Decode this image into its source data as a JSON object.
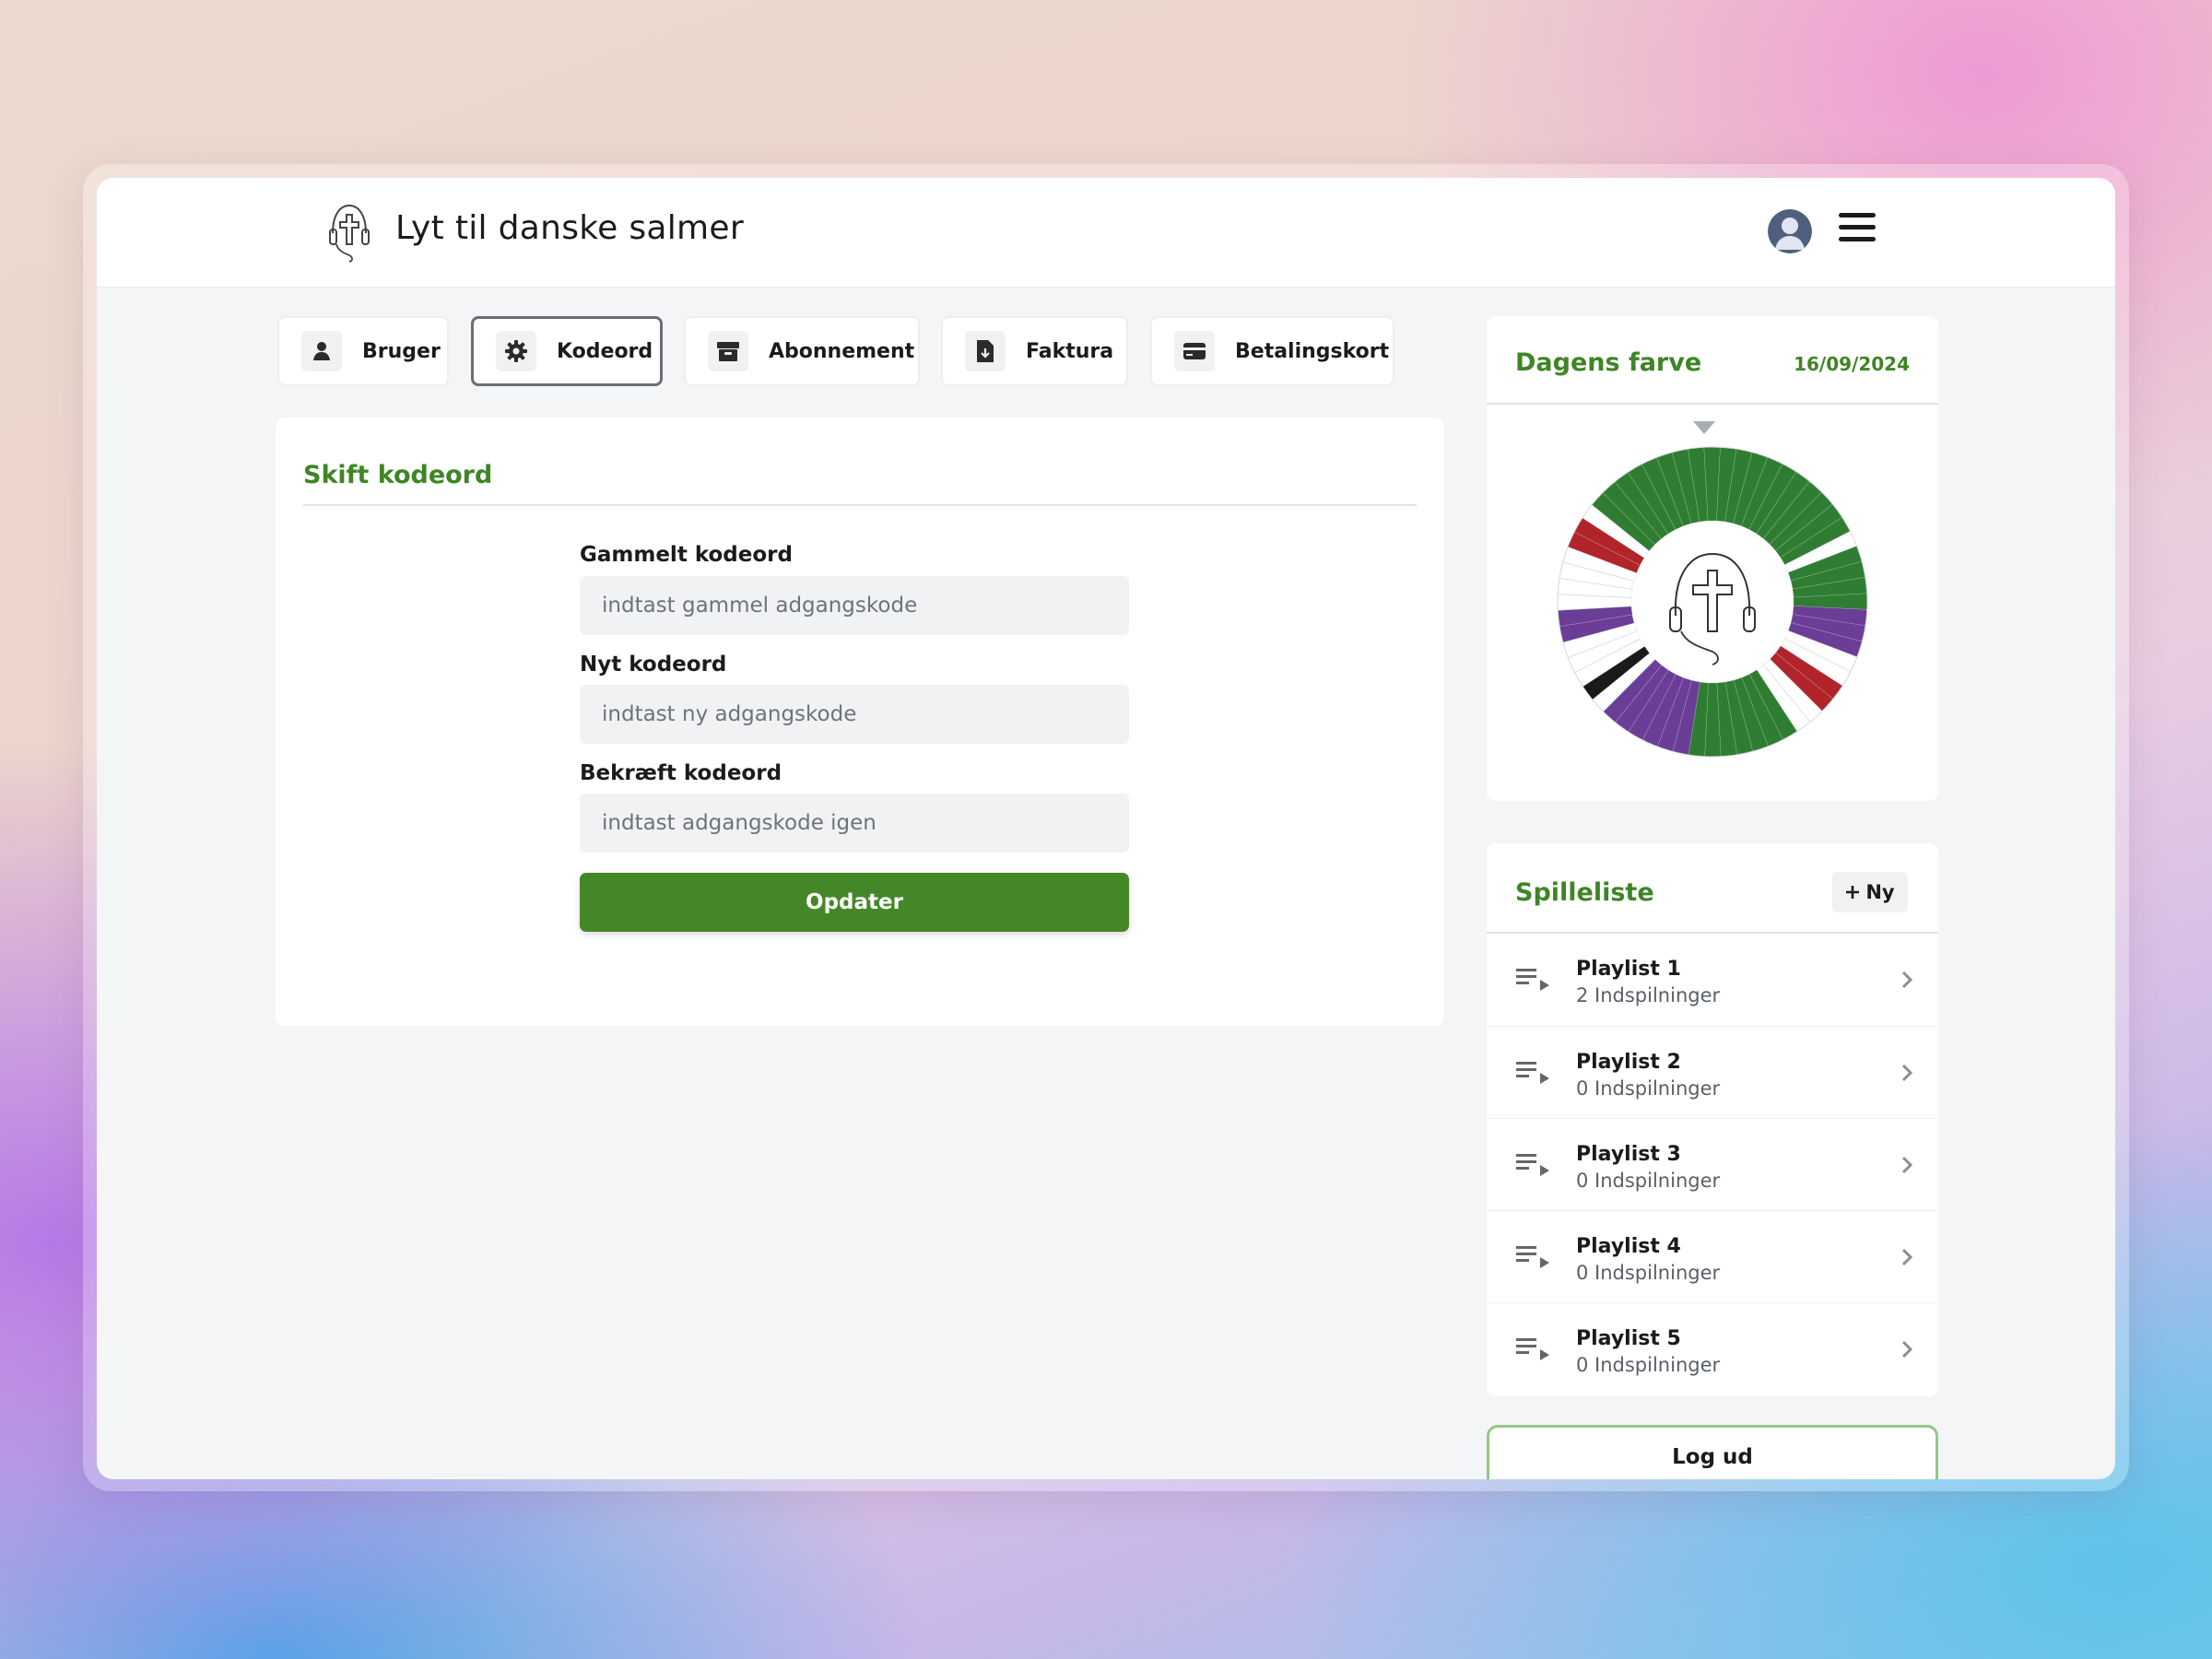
{
  "app": {
    "title": "Lyt til danske salmer"
  },
  "tabs": [
    {
      "label": "Bruger",
      "icon": "user-icon",
      "active": false
    },
    {
      "label": "Kodeord",
      "icon": "gear-icon",
      "active": true
    },
    {
      "label": "Abonnement",
      "icon": "box-icon",
      "active": false
    },
    {
      "label": "Faktura",
      "icon": "file-download-icon",
      "active": false
    },
    {
      "label": "Betalingskort",
      "icon": "credit-card-icon",
      "active": false
    }
  ],
  "password_form": {
    "title": "Skift kodeord",
    "old_label": "Gammelt kodeord",
    "old_placeholder": "indtast gammel adgangskode",
    "new_label": "Nyt kodeord",
    "new_placeholder": "indtast ny adgangskode",
    "confirm_label": "Bekræft kodeord",
    "confirm_placeholder": "indtast adgangskode igen",
    "submit_label": "Opdater"
  },
  "color_of_day": {
    "title": "Dagens farve",
    "date": "16/09/2024",
    "wheel_colors": {
      "green": "#2f7d32",
      "purple": "#6a3d96",
      "red": "#b1242a",
      "white": "#ffffff",
      "black": "#1a1a1a"
    },
    "wheel_segments": [
      "green",
      "green",
      "green",
      "green",
      "green",
      "green",
      "green",
      "green",
      "green",
      "green",
      "white",
      "green",
      "green",
      "green",
      "green",
      "purple",
      "purple",
      "purple",
      "white",
      "white",
      "red",
      "red",
      "white",
      "white",
      "green",
      "green",
      "green",
      "green",
      "green",
      "green",
      "green",
      "purple",
      "purple",
      "purple",
      "purple",
      "purple",
      "purple",
      "white",
      "black",
      "white",
      "white",
      "white",
      "purple",
      "purple",
      "white",
      "white",
      "white",
      "white",
      "red",
      "red",
      "white",
      "green",
      "green",
      "green",
      "green",
      "green",
      "green",
      "green",
      "green",
      "green"
    ]
  },
  "playlists": {
    "title": "Spilleliste",
    "new_label": "Ny",
    "items": [
      {
        "name": "Playlist 1",
        "count": "2 Indspilninger"
      },
      {
        "name": "Playlist 2",
        "count": "0 Indspilninger"
      },
      {
        "name": "Playlist 3",
        "count": "0 Indspilninger"
      },
      {
        "name": "Playlist 4",
        "count": "0 Indspilninger"
      },
      {
        "name": "Playlist 5",
        "count": "0 Indspilninger"
      }
    ]
  },
  "logout_label": "Log ud"
}
